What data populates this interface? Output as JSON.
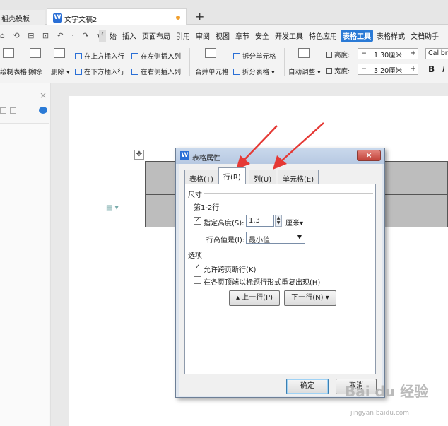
{
  "tabs": {
    "tab1": "稻壳模板",
    "tab2": "文字文稿2",
    "new_tab": "+"
  },
  "menus": {
    "qa": "⌂ ⟲ ⊟ ⊡ ↶ · ↷ ▾",
    "items": [
      "始",
      "插入",
      "页面布局",
      "引用",
      "审阅",
      "视图",
      "章节",
      "安全",
      "开发工具",
      "特色应用",
      "表格工具",
      "表格样式",
      "文档助手"
    ],
    "chev": "‹"
  },
  "ribbon": {
    "draw_table": "绘制表格",
    "erase": "擦除",
    "delete": "删除 ▾",
    "insert_above": "在上方插入行",
    "insert_below": "在下方插入行",
    "insert_left": "在左侧插入列",
    "insert_right": "在右侧插入列",
    "merge_cells": "合并单元格",
    "split_cells": "拆分单元格",
    "split_table": "拆分表格 ▾",
    "auto_fit": "自动调整 ▾",
    "height_label": "高度:",
    "height_value": "1.30厘米",
    "width_label": "宽度:",
    "width_value": "3.20厘米",
    "minus": "−",
    "plus": "+",
    "font": "Calibri",
    "bold": "B",
    "italic": "I"
  },
  "left_pane": {
    "close": "×"
  },
  "dialog": {
    "title": "表格属性",
    "close": "×",
    "tabs": [
      "表格(T)",
      "行(R)",
      "列(U)",
      "单元格(E)"
    ],
    "selected_tab": "行(R)",
    "size_group": "尺寸",
    "row_range": "第1-2行",
    "specify_height_label": "指定高度(S):",
    "specify_height_checked": true,
    "height_value": "1.3",
    "height_unit": "厘米▾",
    "row_height_is_label": "行高值是(I):",
    "row_height_is_value": "最小值",
    "options_group": "选项",
    "allow_break_label": "允许跨页断行(K)",
    "allow_break_checked": true,
    "repeat_header_label": "在各页顶端以标题行形式重复出现(H)",
    "repeat_header_checked": false,
    "prev_row": "▴ 上一行(P)",
    "next_row": "下一行(N) ▾",
    "ok": "确定",
    "cancel": "取消"
  },
  "watermark": {
    "main": "Bai du 经验",
    "sub": "jingyan.baidu.com"
  },
  "colors": {
    "accent": "#2a7ad6",
    "arrow": "#e53935"
  }
}
